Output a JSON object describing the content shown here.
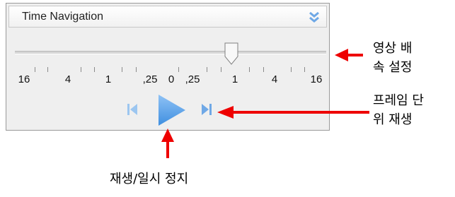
{
  "panel": {
    "title": "Time Navigation",
    "collapse_icon": "double-chevron-down-icon",
    "accent_color": "#5aa0e8"
  },
  "speed_slider": {
    "ticks": [
      "16",
      "4",
      "1",
      ",25",
      "0",
      ",25",
      "1",
      "4",
      "16"
    ],
    "thumb_value": "1"
  },
  "controls": {
    "prev_frame_icon": "step-backward-icon",
    "play_pause_icon": "play-icon",
    "next_frame_icon": "step-forward-icon"
  },
  "annotations": {
    "speed_line1": "영상 배",
    "speed_line2": "속 설정",
    "frame_line1": "프레임 단",
    "frame_line2": "위 재생",
    "play_pause": "재생/일시 정지",
    "arrow_color": "#ee0000"
  }
}
